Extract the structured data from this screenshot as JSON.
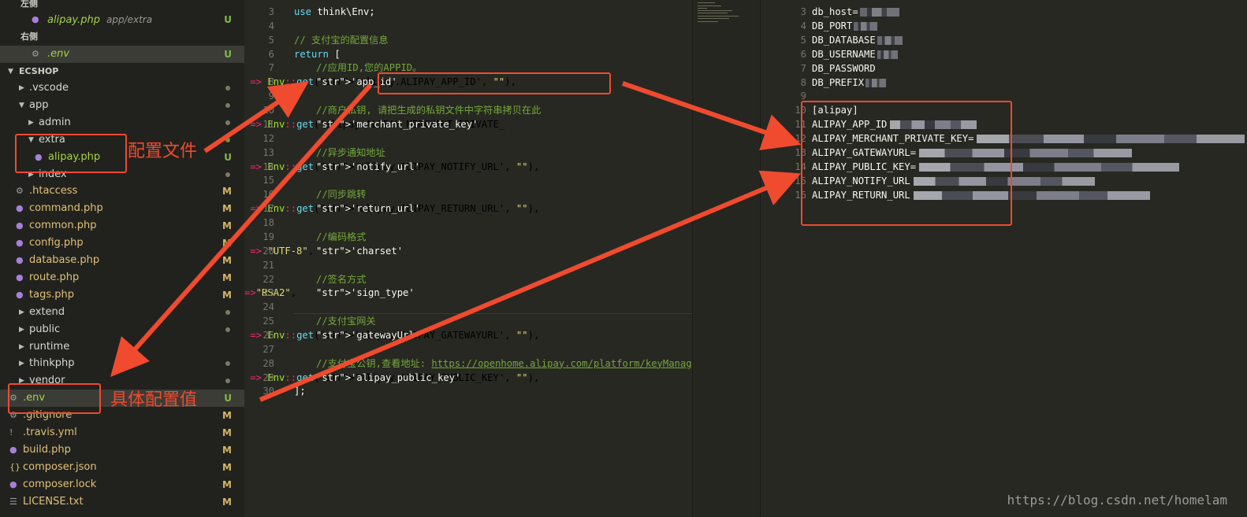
{
  "sidebar": {
    "open_editors": {
      "group_left": "左侧",
      "left_file": {
        "name": "alipay.php",
        "path": "app/extra",
        "status": "U"
      },
      "group_right": "右侧",
      "right_file": {
        "name": ".env",
        "status": "U"
      }
    },
    "project_name": "ECSHOP",
    "tree": [
      {
        "name": ".vscode",
        "type": "folder",
        "status": "dot"
      },
      {
        "name": "app",
        "type": "folder-open",
        "status": "dot"
      },
      {
        "name": "admin",
        "type": "folder",
        "status": "dot"
      },
      {
        "name": "extra",
        "type": "folder-open",
        "status": "dot-green"
      },
      {
        "name": "alipay.php",
        "type": "php",
        "status": "U"
      },
      {
        "name": "index",
        "type": "folder",
        "status": "dot"
      },
      {
        "name": ".htaccess",
        "type": "gear",
        "status": "M"
      },
      {
        "name": "command.php",
        "type": "php",
        "status": "M"
      },
      {
        "name": "common.php",
        "type": "php",
        "status": "M"
      },
      {
        "name": "config.php",
        "type": "php",
        "status": "M"
      },
      {
        "name": "database.php",
        "type": "php",
        "status": "M"
      },
      {
        "name": "route.php",
        "type": "php",
        "status": "M"
      },
      {
        "name": "tags.php",
        "type": "php",
        "status": "M"
      },
      {
        "name": "extend",
        "type": "folder",
        "status": "dot"
      },
      {
        "name": "public",
        "type": "folder",
        "status": "dot"
      },
      {
        "name": "runtime",
        "type": "folder",
        "status": ""
      },
      {
        "name": "thinkphp",
        "type": "folder",
        "status": "dot"
      },
      {
        "name": "vendor",
        "type": "folder",
        "status": "dot"
      },
      {
        "name": ".env",
        "type": "gear",
        "status": "U"
      },
      {
        "name": ".gitignore",
        "type": "gear",
        "status": "M"
      },
      {
        "name": ".travis.yml",
        "type": "yml",
        "status": "M"
      },
      {
        "name": "build.php",
        "type": "php",
        "status": "M"
      },
      {
        "name": "composer.json",
        "type": "json",
        "status": "M"
      },
      {
        "name": "composer.lock",
        "type": "lock",
        "status": "M"
      },
      {
        "name": "LICENSE.txt",
        "type": "txt",
        "status": "M"
      }
    ]
  },
  "editor_left": {
    "lines": [
      {
        "n": "3",
        "t": "use think\\Env;"
      },
      {
        "n": "4",
        "t": ""
      },
      {
        "n": "5",
        "t": "// 支付宝的配置信息"
      },
      {
        "n": "6",
        "t": "return ["
      },
      {
        "n": "7",
        "t": "//应用ID,您的APPID。"
      },
      {
        "n": "8",
        "t": "'app_id' => Env::get('alipay.ALIPAY_APP_ID', \"\"),"
      },
      {
        "n": "9",
        "t": ""
      },
      {
        "n": "10",
        "t": "//商户私钥, 请把生成的私钥文件中字符串拷贝在此"
      },
      {
        "n": "11",
        "t": "'merchant_private_key' => Env::get('alipay.ALIPAY_MERCHANT_PRIVATE_"
      },
      {
        "n": "12",
        "t": ""
      },
      {
        "n": "13",
        "t": "//异步通知地址"
      },
      {
        "n": "14",
        "t": "'notify_url' => Env::get('alipay.ALIPAY_NOTIFY_URL', \"\"),"
      },
      {
        "n": "15",
        "t": ""
      },
      {
        "n": "16",
        "t": "//同步跳转"
      },
      {
        "n": "17",
        "t": "'return_url' => Env::get('alipay.ALIPAY_RETURN_URL', \"\"),"
      },
      {
        "n": "18",
        "t": ""
      },
      {
        "n": "19",
        "t": "//编码格式"
      },
      {
        "n": "20",
        "t": "'charset' => \"UTF-8\","
      },
      {
        "n": "21",
        "t": ""
      },
      {
        "n": "22",
        "t": "//签名方式"
      },
      {
        "n": "23",
        "t": "'sign_type'=>\"RSA2\","
      },
      {
        "n": "24",
        "t": ""
      },
      {
        "n": "25",
        "t": "//支付宝网关"
      },
      {
        "n": "26",
        "t": "'gatewayUrl' => Env::get('alipay.ALIPAY_GATEWAYURL', \"\"),"
      },
      {
        "n": "27",
        "t": ""
      },
      {
        "n": "28",
        "t": "//支付宝公钥,查看地址: https://openhome.alipay.com/platform/keyManage."
      },
      {
        "n": "29",
        "t": "'alipay_public_key' => Env::get('alipay.ALIPAY_PUBLIC_KEY', \"\"),"
      },
      {
        "n": "30",
        "t": "];"
      }
    ]
  },
  "editor_right": {
    "lines": [
      {
        "n": "3",
        "t": "db_host="
      },
      {
        "n": "4",
        "t": "DB_PORT"
      },
      {
        "n": "5",
        "t": "DB_DATABASE"
      },
      {
        "n": "6",
        "t": "DB_USERNAME"
      },
      {
        "n": "7",
        "t": "DB_PASSWORD"
      },
      {
        "n": "8",
        "t": "DB_PREFIX"
      },
      {
        "n": "9",
        "t": ""
      },
      {
        "n": "10",
        "t": "[alipay]"
      },
      {
        "n": "11",
        "t": "ALIPAY_APP_ID"
      },
      {
        "n": "12",
        "t": "ALIPAY_MERCHANT_PRIVATE_KEY="
      },
      {
        "n": "13",
        "t": "ALIPAY_GATEWAYURL="
      },
      {
        "n": "14",
        "t": "ALIPAY_PUBLIC_KEY="
      },
      {
        "n": "15",
        "t": "ALIPAY_NOTIFY_URL"
      },
      {
        "n": "16",
        "t": "ALIPAY_RETURN_URL"
      }
    ]
  },
  "annotations": {
    "config_file": "配置文件",
    "config_values": "具体配置值",
    "color": "#f04a2f"
  },
  "watermark": "https://blog.csdn.net/homelam"
}
